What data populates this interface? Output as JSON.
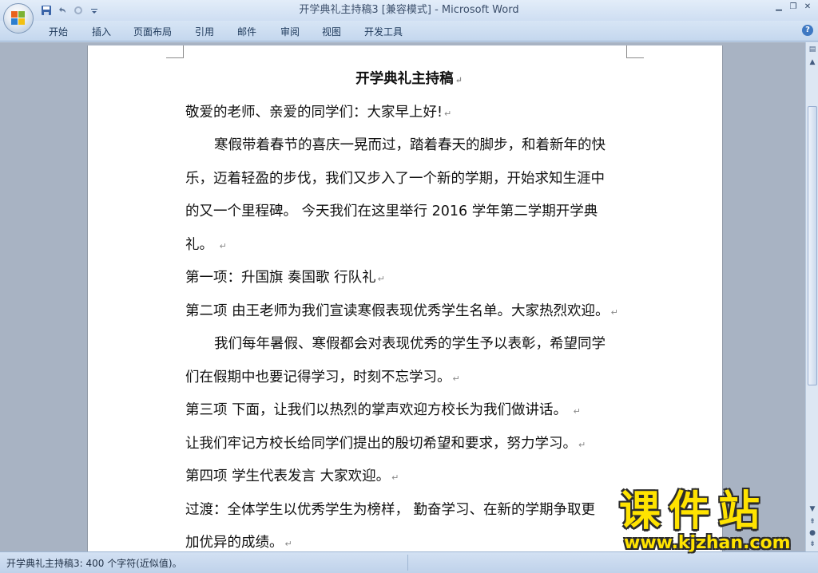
{
  "window": {
    "title": "开学典礼主持稿3 [兼容模式] - Microsoft Word",
    "minimize_glyph": "▁",
    "restore_glyph": "❐",
    "close_glyph": "✕",
    "help_glyph": "?"
  },
  "quick_access": {
    "save_icon": "save-icon",
    "undo_icon": "undo-icon",
    "redo_icon": "redo-icon",
    "customize_icon": "customize-icon"
  },
  "ribbon": {
    "tabs": [
      "开始",
      "插入",
      "页面布局",
      "引用",
      "邮件",
      "审阅",
      "视图",
      "开发工具"
    ]
  },
  "document": {
    "lines": [
      {
        "text": "开学典礼主持稿",
        "style": "title"
      },
      {
        "text": "敬爱的老师、亲爱的同学们：大家早上好!",
        "style": "normal"
      },
      {
        "text": "寒假带着春节的喜庆一晃而过，踏着春天的脚步，和着新年的快",
        "style": "indent",
        "nomark": true
      },
      {
        "text": "乐，迈着轻盈的步伐，我们又步入了一个新的学期，开始求知生涯中",
        "style": "normal",
        "nomark": true
      },
      {
        "text": "的又一个里程碑。 今天我们在这里举行 2016 学年第二学期开学典",
        "style": "normal",
        "nomark": true
      },
      {
        "text": "礼。 ",
        "style": "normal"
      },
      {
        "text": "第一项：升国旗 奏国歌 行队礼",
        "style": "normal"
      },
      {
        "text": "第二项  由王老师为我们宣读寒假表现优秀学生名单。大家热烈欢迎。",
        "style": "normal"
      },
      {
        "text": "我们每年暑假、寒假都会对表现优秀的学生予以表彰，希望同学",
        "style": "indent",
        "nomark": true
      },
      {
        "text": "们在假期中也要记得学习，时刻不忘学习。",
        "style": "normal"
      },
      {
        "text": "第三项  下面，让我们以热烈的掌声欢迎方校长为我们做讲话。  ",
        "style": "normal"
      },
      {
        "text": "让我们牢记方校长给同学们提出的殷切希望和要求，努力学习。",
        "style": "normal"
      },
      {
        "text": "第四项  学生代表发言  大家欢迎。",
        "style": "normal"
      },
      {
        "text": "过渡：全体学生以优秀学生为榜样， 勤奋学习、在新的学期争取更",
        "style": "normal",
        "nomark": true
      },
      {
        "text": "加优异的成绩。",
        "style": "normal"
      }
    ],
    "paragraph_mark": "↵"
  },
  "status_bar": {
    "text": "开学典礼主持稿3: 400 个字符(近似值)。"
  },
  "watermark": {
    "brand": "课件站",
    "url": "www.kjzhan.com"
  }
}
